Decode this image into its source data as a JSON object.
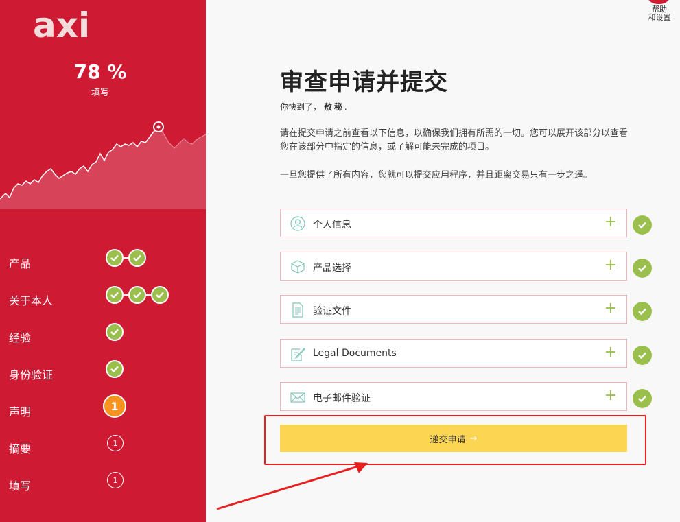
{
  "sidebar": {
    "logo_text": "axi",
    "progress_percent": "78 %",
    "progress_label": "填写",
    "progress_value": 78,
    "steps": [
      {
        "label": "产品",
        "status": "done",
        "checks": 2
      },
      {
        "label": "关于本人",
        "status": "done",
        "checks": 3
      },
      {
        "label": "经验",
        "status": "done",
        "checks": 1
      },
      {
        "label": "身份验证",
        "status": "done",
        "checks": 1
      },
      {
        "label": "声明",
        "status": "current",
        "number": "1"
      },
      {
        "label": "摘要",
        "status": "pending",
        "number": "1"
      },
      {
        "label": "填写",
        "status": "pending",
        "number": "1"
      }
    ]
  },
  "header": {
    "help_label_line1": "帮助",
    "help_label_line2": "和设置"
  },
  "main": {
    "title": "审查申请并提交",
    "subtitle_prefix": "你快到了，",
    "subtitle_bold": "敖秘",
    "subtitle_suffix": ".",
    "paragraph1": "请在提交申请之前查看以下信息，以确保我们拥有所需的一切。您可以展开该部分以查看您在该部分中指定的信息，或了解可能未完成的项目。",
    "paragraph2": "一旦您提供了所有内容，您就可以提交应用程序，并且距离交易只有一步之遥。",
    "sections": [
      {
        "label": "个人信息",
        "icon": "user-icon",
        "expand": "+"
      },
      {
        "label": "产品选择",
        "icon": "box-icon",
        "expand": "+"
      },
      {
        "label": "验证文件",
        "icon": "document-icon",
        "expand": "+"
      },
      {
        "label": "Legal Documents",
        "icon": "pen-icon",
        "expand": "+"
      },
      {
        "label": "电子邮件验证",
        "icon": "envelope-icon",
        "expand": "+"
      }
    ],
    "submit_label": "递交申请",
    "submit_arrow": "→"
  },
  "colors": {
    "brand_red": "#cf1a34",
    "check_green": "#9bbf4c",
    "submit_yellow": "#fcd652",
    "current_orange": "#f7931e",
    "annotation_red": "#e8201f"
  }
}
